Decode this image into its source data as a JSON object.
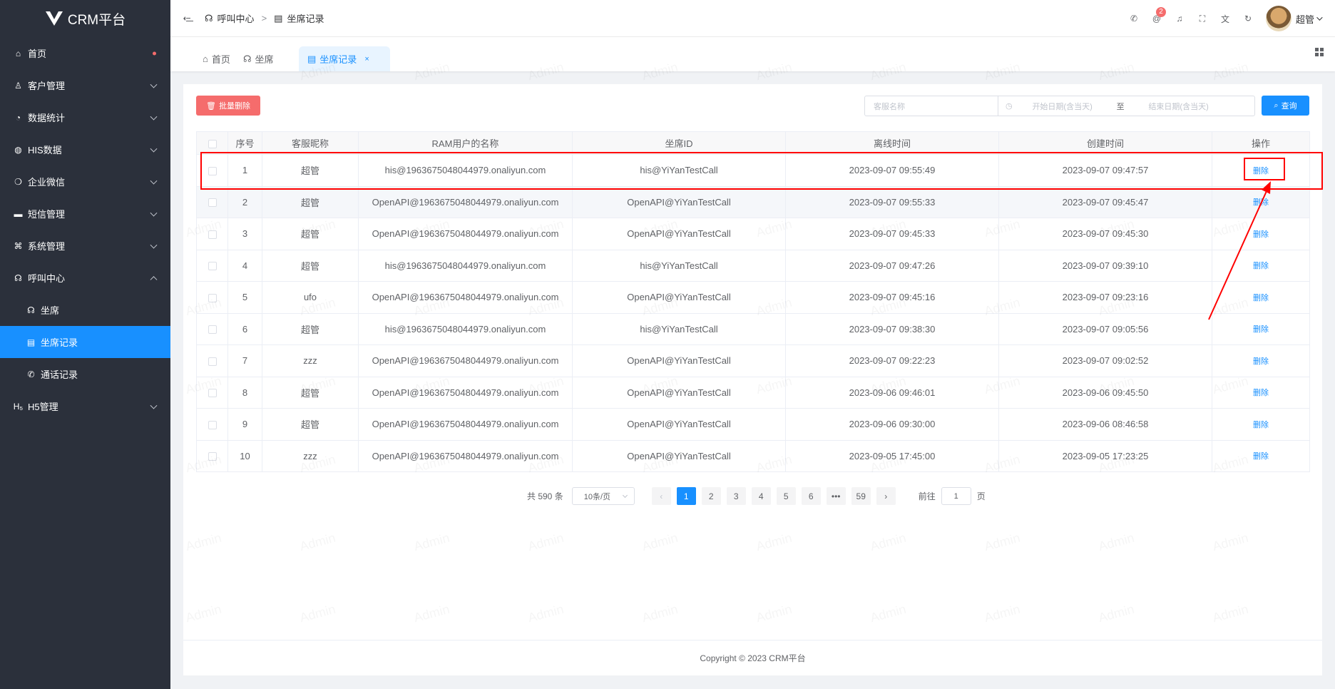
{
  "app": {
    "title": "CRM平台"
  },
  "sidebar": {
    "items": [
      {
        "label": "首页",
        "icon": "home-icon",
        "has_dot": true
      },
      {
        "label": "客户管理",
        "icon": "user-icon"
      },
      {
        "label": "数据统计",
        "icon": "chart-icon"
      },
      {
        "label": "HIS数据",
        "icon": "database-icon"
      },
      {
        "label": "企业微信",
        "icon": "wechat-icon"
      },
      {
        "label": "短信管理",
        "icon": "message-icon"
      },
      {
        "label": "系统管理",
        "icon": "command-icon"
      },
      {
        "label": "呼叫中心",
        "icon": "headset-icon",
        "expanded": true
      },
      {
        "label": "坐席",
        "icon": "headset-icon",
        "sub": true
      },
      {
        "label": "坐席记录",
        "icon": "clipboard-icon",
        "sub": true,
        "active": true
      },
      {
        "label": "通话记录",
        "icon": "phone-icon",
        "sub": true
      },
      {
        "label": "H5管理",
        "icon": "h5-icon"
      }
    ]
  },
  "header": {
    "breadcrumb": [
      "呼叫中心",
      "坐席记录"
    ],
    "notification_count": "2",
    "user_name": "超管"
  },
  "tabs": [
    {
      "label": "首页",
      "icon": "home-icon"
    },
    {
      "label": "坐席",
      "icon": "headset-icon"
    },
    {
      "label": "坐席记录",
      "icon": "clipboard-icon",
      "active": true,
      "close": "×"
    }
  ],
  "toolbar": {
    "batch_delete_label": "批量删除",
    "name_placeholder": "客服名称",
    "start_date_placeholder": "开始日期(含当天)",
    "date_separator": "至",
    "end_date_placeholder": "结束日期(含当天)",
    "search_label": "查询"
  },
  "table": {
    "columns": [
      "序号",
      "客服昵称",
      "RAM用户的名称",
      "坐席ID",
      "离线时间",
      "创建时间",
      "操作"
    ],
    "rows": [
      {
        "no": "1",
        "nick": "超管",
        "ram": "his@1963675048044979.onaliyun.com",
        "seat": "his@YiYanTestCall",
        "offline": "2023-09-07 09:55:49",
        "created": "2023-09-07 09:47:57",
        "op": "删除"
      },
      {
        "no": "2",
        "nick": "超管",
        "ram": "OpenAPI@1963675048044979.onaliyun.com",
        "seat": "OpenAPI@YiYanTestCall",
        "offline": "2023-09-07 09:55:33",
        "created": "2023-09-07 09:45:47",
        "op": "删除"
      },
      {
        "no": "3",
        "nick": "超管",
        "ram": "OpenAPI@1963675048044979.onaliyun.com",
        "seat": "OpenAPI@YiYanTestCall",
        "offline": "2023-09-07 09:45:33",
        "created": "2023-09-07 09:45:30",
        "op": "删除"
      },
      {
        "no": "4",
        "nick": "超管",
        "ram": "his@1963675048044979.onaliyun.com",
        "seat": "his@YiYanTestCall",
        "offline": "2023-09-07 09:47:26",
        "created": "2023-09-07 09:39:10",
        "op": "删除"
      },
      {
        "no": "5",
        "nick": "ufo",
        "ram": "OpenAPI@1963675048044979.onaliyun.com",
        "seat": "OpenAPI@YiYanTestCall",
        "offline": "2023-09-07 09:45:16",
        "created": "2023-09-07 09:23:16",
        "op": "删除"
      },
      {
        "no": "6",
        "nick": "超管",
        "ram": "his@1963675048044979.onaliyun.com",
        "seat": "his@YiYanTestCall",
        "offline": "2023-09-07 09:38:30",
        "created": "2023-09-07 09:05:56",
        "op": "删除"
      },
      {
        "no": "7",
        "nick": "zzz",
        "ram": "OpenAPI@1963675048044979.onaliyun.com",
        "seat": "OpenAPI@YiYanTestCall",
        "offline": "2023-09-07 09:22:23",
        "created": "2023-09-07 09:02:52",
        "op": "删除"
      },
      {
        "no": "8",
        "nick": "超管",
        "ram": "OpenAPI@1963675048044979.onaliyun.com",
        "seat": "OpenAPI@YiYanTestCall",
        "offline": "2023-09-06 09:46:01",
        "created": "2023-09-06 09:45:50",
        "op": "删除"
      },
      {
        "no": "9",
        "nick": "超管",
        "ram": "OpenAPI@1963675048044979.onaliyun.com",
        "seat": "OpenAPI@YiYanTestCall",
        "offline": "2023-09-06 09:30:00",
        "created": "2023-09-06 08:46:58",
        "op": "删除"
      },
      {
        "no": "10",
        "nick": "zzz",
        "ram": "OpenAPI@1963675048044979.onaliyun.com",
        "seat": "OpenAPI@YiYanTestCall",
        "offline": "2023-09-05 17:45:00",
        "created": "2023-09-05 17:23:25",
        "op": "删除"
      }
    ]
  },
  "pagination": {
    "total": "共 590 条",
    "page_size": "10条/页",
    "prev": "‹",
    "pages": [
      "1",
      "2",
      "3",
      "4",
      "5",
      "6",
      "•••",
      "59"
    ],
    "next": "›",
    "goto_label": "前往",
    "goto_value": "1",
    "goto_suffix": "页"
  },
  "footer": {
    "text": "Copyright ©  2023 CRM平台"
  },
  "watermark": {
    "text": "Admin"
  },
  "colors": {
    "primary": "#1890ff",
    "danger": "#f56c6c",
    "sidebar_bg": "#2b303b",
    "annotation": "#ff0000"
  }
}
